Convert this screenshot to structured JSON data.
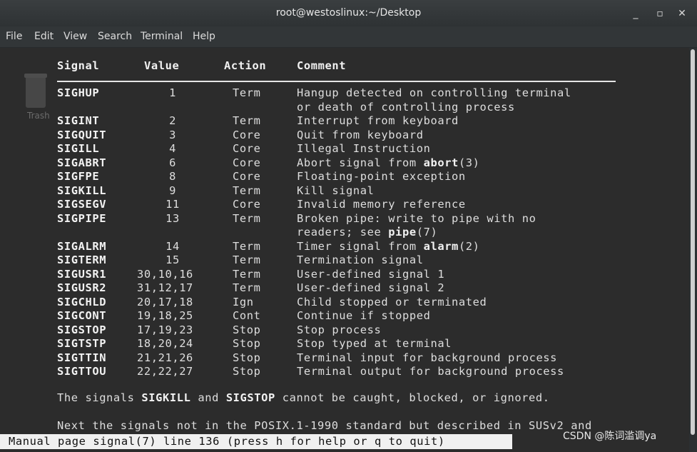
{
  "window": {
    "title": "root@westoslinux:~/Desktop",
    "controls": [
      "_",
      "▫",
      "✕"
    ]
  },
  "menubar": [
    "File",
    "Edit",
    "View",
    "Search",
    "Terminal",
    "Help"
  ],
  "desktop": {
    "trash_label": "Trash"
  },
  "table": {
    "headers": [
      "Signal",
      "Value",
      "Action",
      "Comment"
    ],
    "rows": [
      {
        "signal": "SIGHUP",
        "value": "1",
        "action": "Term",
        "comment": "Hangup detected on controlling terminal",
        "comment2": "or death of controlling process"
      },
      {
        "signal": "SIGINT",
        "value": "2",
        "action": "Term",
        "comment": "Interrupt from keyboard"
      },
      {
        "signal": "SIGQUIT",
        "value": "3",
        "action": "Core",
        "comment": "Quit from keyboard"
      },
      {
        "signal": "SIGILL",
        "value": "4",
        "action": "Core",
        "comment": "Illegal Instruction"
      },
      {
        "signal": "SIGABRT",
        "value": "6",
        "action": "Core",
        "comment": "Abort signal from abort(3)"
      },
      {
        "signal": "SIGFPE",
        "value": "8",
        "action": "Core",
        "comment": "Floating-point exception"
      },
      {
        "signal": "SIGKILL",
        "value": "9",
        "action": "Term",
        "comment": "Kill signal"
      },
      {
        "signal": "SIGSEGV",
        "value": "11",
        "action": "Core",
        "comment": "Invalid memory reference"
      },
      {
        "signal": "SIGPIPE",
        "value": "13",
        "action": "Term",
        "comment": "Broken pipe: write to pipe with no",
        "comment2": "readers; see pipe(7)"
      },
      {
        "signal": "SIGALRM",
        "value": "14",
        "action": "Term",
        "comment": "Timer signal from alarm(2)"
      },
      {
        "signal": "SIGTERM",
        "value": "15",
        "action": "Term",
        "comment": "Termination signal"
      },
      {
        "signal": "SIGUSR1",
        "value": "30,10,16",
        "action": "Term",
        "comment": "User-defined signal 1"
      },
      {
        "signal": "SIGUSR2",
        "value": "31,12,17",
        "action": "Term",
        "comment": "User-defined signal 2"
      },
      {
        "signal": "SIGCHLD",
        "value": "20,17,18",
        "action": "Ign",
        "comment": "Child stopped or terminated"
      },
      {
        "signal": "SIGCONT",
        "value": "19,18,25",
        "action": "Cont",
        "comment": "Continue if stopped"
      },
      {
        "signal": "SIGSTOP",
        "value": "17,19,23",
        "action": "Stop",
        "comment": "Stop process"
      },
      {
        "signal": "SIGTSTP",
        "value": "18,20,24",
        "action": "Stop",
        "comment": "Stop typed at terminal"
      },
      {
        "signal": "SIGTTIN",
        "value": "21,21,26",
        "action": "Stop",
        "comment": "Terminal input for background process"
      },
      {
        "signal": "SIGTTOU",
        "value": "22,22,27",
        "action": "Stop",
        "comment": "Terminal output for background process"
      }
    ]
  },
  "paragraphs": {
    "p1_a": "The signals ",
    "p1_b": "SIGKILL",
    "p1_c": " and ",
    "p1_d": "SIGSTOP",
    "p1_e": " cannot be caught, blocked, or ignored.",
    "p2": "Next the signals not in the POSIX.1-1990 standard but described in SUSv2 and"
  },
  "status_line": "Manual page signal(7) line 136 (press h for help or q to quit)",
  "watermark": "CSDN @陈词滥调ya"
}
